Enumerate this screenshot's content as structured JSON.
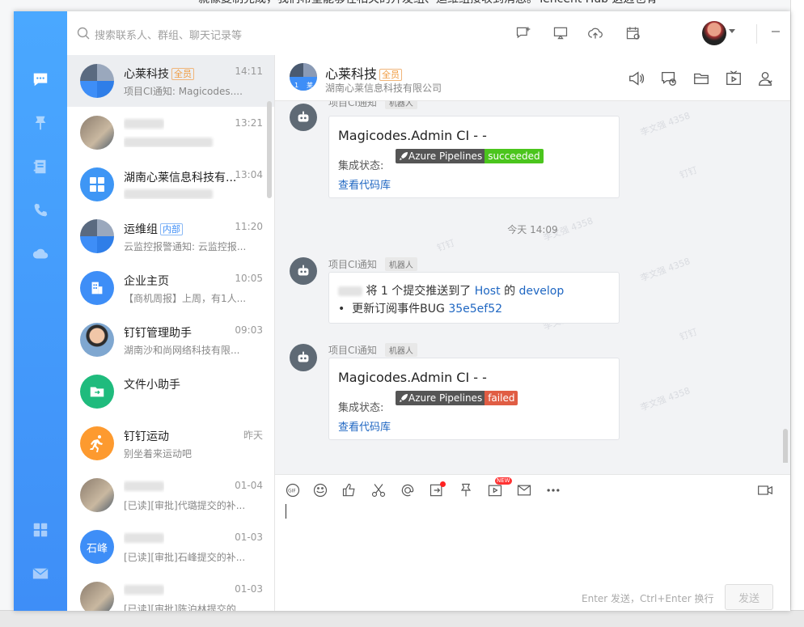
{
  "background_doc": {
    "text": "就像复制完成，我们希望能够在相关的开发组、运维组接收到消息。Tencent Hub 这边也有"
  },
  "search": {
    "placeholder": "搜索联系人、群组、聊天记录等"
  },
  "icons": {
    "nav": [
      "chat-bubble-icon",
      "pin-icon",
      "contacts-book-icon",
      "phone-icon",
      "cloud-icon",
      "apps-grid-icon",
      "mail-icon"
    ],
    "top": [
      "new-message-icon",
      "screen-share-icon",
      "cloud-upload-icon",
      "schedule-icon"
    ]
  },
  "conversations": [
    {
      "name": "心莱科技",
      "tag": "全员",
      "tag_color": "#f09a3e",
      "time": "14:11",
      "preview": "项目CI通知: Magicodes....",
      "avatar": "group-avatar",
      "selected": true
    },
    {
      "name": "",
      "tag": "",
      "time": "13:21",
      "preview": "",
      "avatar": "photo-avatar",
      "selected": false
    },
    {
      "name": "湖南心莱信息科技有...",
      "tag": "",
      "time": "13:04",
      "preview": "",
      "avatar": "apps-avatar",
      "selected": false
    },
    {
      "name": "运维组",
      "tag": "内部",
      "tag_color": "#3e8ef7",
      "time": "11:20",
      "preview": "云监控报警通知: 云监控报...",
      "avatar": "group-avatar",
      "selected": false
    },
    {
      "name": "企业主页",
      "tag": "",
      "time": "10:05",
      "preview": "【商机周报】上周，有1人...",
      "avatar": "building-avatar",
      "selected": false
    },
    {
      "name": "钉钉管理助手",
      "tag": "",
      "time": "09:03",
      "preview": "湖南沙和尚网络科技有限...",
      "avatar": "person-avatar",
      "selected": false
    },
    {
      "name": "文件小助手",
      "tag": "",
      "time": "",
      "preview": "",
      "avatar": "file-avatar",
      "selected": false
    },
    {
      "name": "钉钉运动",
      "tag": "",
      "time": "昨天",
      "preview": "别坐着来运动吧",
      "avatar": "run-avatar",
      "selected": false
    },
    {
      "name": "",
      "tag": "",
      "time": "01-04",
      "preview": "[已读][审批]代璐提交的补...",
      "avatar": "photo-avatar",
      "selected": false
    },
    {
      "name": "",
      "tag": "",
      "time": "01-03",
      "preview": "[已读][审批]石峰提交的补...",
      "avatar": "text-avatar",
      "avatar_text": "石峰",
      "selected": false
    },
    {
      "name": "",
      "tag": "",
      "time": "01-03",
      "preview": "[已读][审批]陈泊林提交的...",
      "avatar": "photo-avatar",
      "selected": false
    }
  ],
  "chat": {
    "title": "心莱科技",
    "title_tag": "全员",
    "subtitle": "湖南心莱信息科技有限公司",
    "timestamp": "今天 14:09",
    "sender_name": "项目CI通知",
    "bot_label": "机器人",
    "watermark": "李文强 4358",
    "watermark_alt": "钉钉",
    "messages": [
      {
        "type": "ci",
        "title": "Magicodes.Admin CI - -",
        "status_label": "集成状态:",
        "badge_left": "Azure Pipelines",
        "badge_right": "succeeded",
        "badge_color": "#4bc51d",
        "link": "查看代码库"
      },
      {
        "type": "push",
        "line1_pre": "将 1 个提交推送到了",
        "line1_repo": "Host",
        "line1_mid": "的",
        "line1_branch": "develop",
        "bullet_text": "更新订阅事件BUG",
        "commit": "35e5ef52"
      },
      {
        "type": "ci",
        "title": "Magicodes.Admin CI - -",
        "status_label": "集成状态:",
        "badge_left": "Azure Pipelines",
        "badge_right": "failed",
        "badge_color": "#e05d44",
        "link": "查看代码库"
      }
    ]
  },
  "composer": {
    "new_badge": "NEW",
    "gif_label": "GIF",
    "hint": "Enter 发送，Ctrl+Enter 换行",
    "send_label": "发送"
  }
}
